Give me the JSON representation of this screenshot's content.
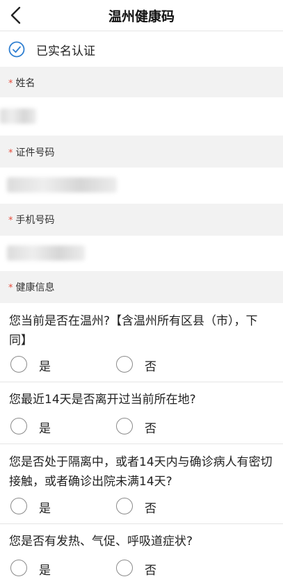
{
  "nav": {
    "title": "温州健康码"
  },
  "verification": {
    "label": "已实名认证"
  },
  "sections": {
    "name": {
      "star": "*",
      "label": "姓名"
    },
    "id": {
      "star": "*",
      "label": "证件号码"
    },
    "phone": {
      "star": "*",
      "label": "手机号码"
    },
    "health": {
      "star": "*",
      "label": "健康信息"
    }
  },
  "questions": [
    {
      "text": "您当前是否在温州?【含温州所有区县（市），下同】",
      "yes": "是",
      "no": "否"
    },
    {
      "text": "您最近14天是否离开过当前所在地?",
      "yes": "是",
      "no": "否"
    },
    {
      "text": "您是否处于隔离中，或者14天内与确诊病人有密切接触，或者确诊出院未满14天?",
      "yes": "是",
      "no": "否"
    },
    {
      "text": "您是否有发热、气促、呼吸道症状?",
      "yes": "是",
      "no": "否"
    }
  ],
  "colors": {
    "accent": "#2f7fd1",
    "required_star": "#e64b3b",
    "section_bg": "#f2f2f2"
  }
}
